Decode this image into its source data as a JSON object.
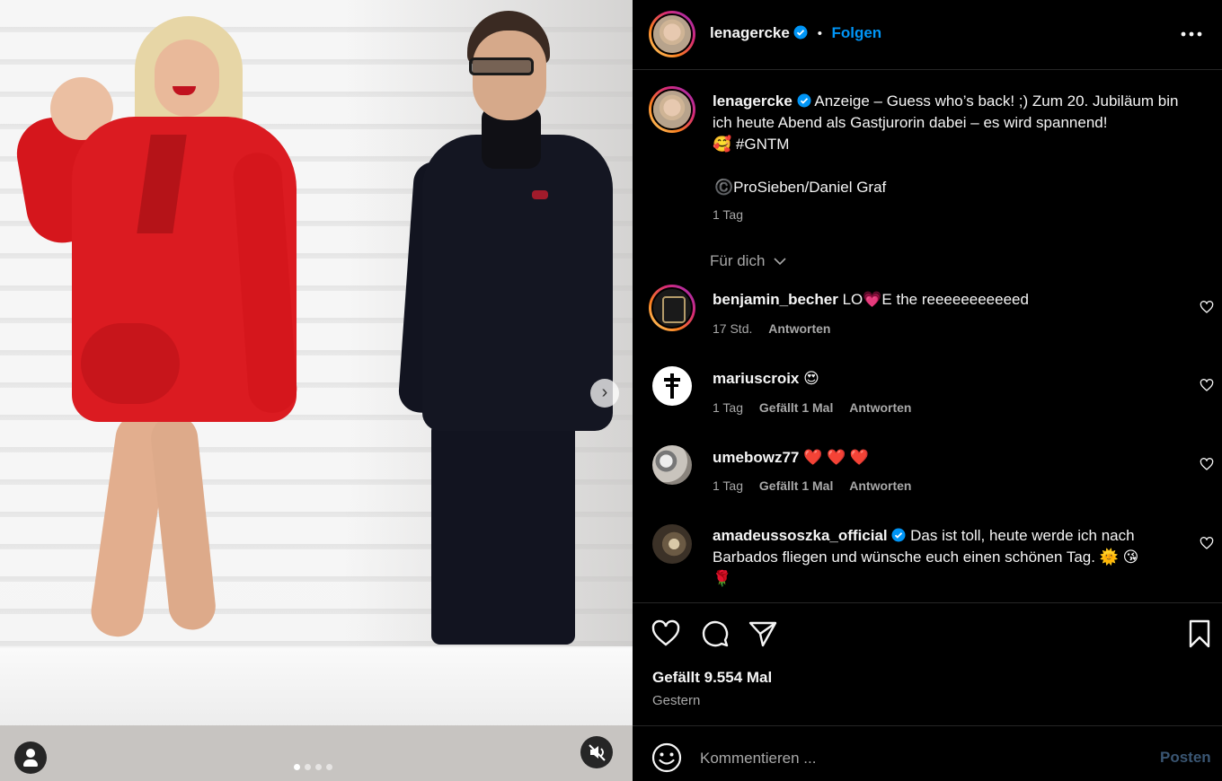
{
  "post": {
    "username": "lenagercke",
    "follow_label": "Folgen",
    "separator": "•",
    "caption": "Anzeige – Guess who’s back! ;) Zum 20. Jubiläum bin ich heute Abend als Gastjurorin dabei – es wird spannend!",
    "caption_emoji": "🥰",
    "hashtag": "#GNTM",
    "credit": "©️ProSieben/Daniel Graf",
    "caption_age": "1 Tag",
    "filter_label": "Für dich",
    "carousel": {
      "slide_count": 4,
      "active_index": 0
    }
  },
  "comments": [
    {
      "username": "benjamin_becher",
      "verified": false,
      "text_before": "LO",
      "emoji_mid": "💗",
      "text_after": "E the reeeeeeeeeeed",
      "age": "17 Std.",
      "likes": "",
      "reply": "Antworten"
    },
    {
      "username": "mariuscroix",
      "verified": false,
      "text_before": "",
      "emoji_mid": "😍",
      "text_after": "",
      "age": "1 Tag",
      "likes": "Gefällt 1 Mal",
      "reply": "Antworten"
    },
    {
      "username": "umebowz77",
      "verified": false,
      "text_before": "",
      "emoji_mid": "❤️ ❤️ ❤️",
      "text_after": "",
      "age": "1 Tag",
      "likes": "Gefällt 1 Mal",
      "reply": "Antworten"
    },
    {
      "username": "amadeussoszka_official",
      "verified": true,
      "text_before": "Das ist toll, heute werde ich nach Barbados fliegen und wünsche euch einen schönen Tag.",
      "emoji_mid": "🌞 😘",
      "text_after": "🌹",
      "age": "",
      "likes": "",
      "reply": ""
    }
  ],
  "actions": {
    "likes_text": "Gefällt 9.554 Mal",
    "date_text": "Gestern"
  },
  "composer": {
    "placeholder": "Kommentieren ...",
    "post_label": "Posten"
  },
  "colors": {
    "accent": "#0095f6",
    "background": "#000000",
    "muted": "#a8a8a8",
    "like_red": "#ff3040"
  },
  "icons": [
    "user-tag-icon",
    "mute-icon",
    "chevron-right-icon",
    "more-icon",
    "verified-icon",
    "chevron-down-icon",
    "heart-icon",
    "comment-icon",
    "share-icon",
    "bookmark-icon",
    "emoji-icon"
  ]
}
